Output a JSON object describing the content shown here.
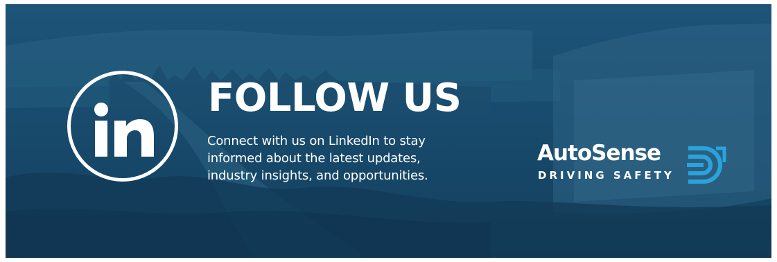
{
  "banner": {
    "headline": "FOLLOW US",
    "blurb_lines": [
      "Connect with us on LinkedIn to stay",
      "informed about the latest updates,",
      "industry insights, and opportunities."
    ],
    "linkedin_icon": "linkedin-in-icon",
    "logo": {
      "name": "AutoSense",
      "tagline": "DRIVING SAFETY",
      "mark_icon": "autosense-mark-icon"
    }
  },
  "colors": {
    "background": "#184b6d",
    "text": "#ffffff",
    "logo_accent": "#2aa3dc"
  }
}
